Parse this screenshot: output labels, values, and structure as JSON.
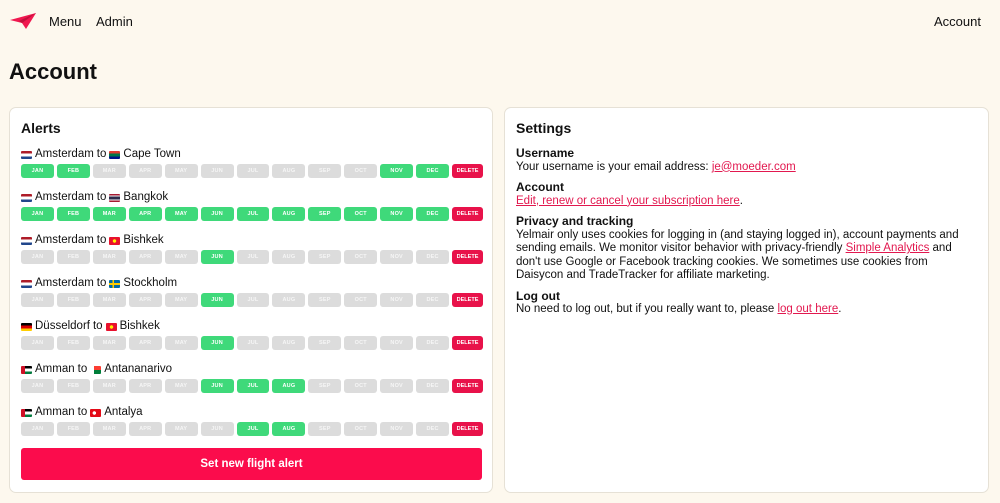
{
  "nav": {
    "menu": "Menu",
    "admin": "Admin",
    "account": "Account",
    "logo_color": "#f0184f"
  },
  "page": {
    "title": "Account"
  },
  "alerts": {
    "title": "Alerts",
    "delete_label": "DELETE",
    "new_alert_label": "Set new flight alert",
    "months": [
      "JAN",
      "FEB",
      "MAR",
      "APR",
      "MAY",
      "JUN",
      "JUL",
      "AUG",
      "SEP",
      "OCT",
      "NOV",
      "DEC"
    ],
    "items": [
      {
        "from": "Amsterdam",
        "from_flag": "nl",
        "to": "Cape Town",
        "to_flag": "za",
        "active": [
          true,
          true,
          false,
          false,
          false,
          false,
          false,
          false,
          false,
          false,
          true,
          true
        ]
      },
      {
        "from": "Amsterdam",
        "from_flag": "nl",
        "to": "Bangkok",
        "to_flag": "th",
        "active": [
          true,
          true,
          true,
          true,
          true,
          true,
          true,
          true,
          true,
          true,
          true,
          true
        ]
      },
      {
        "from": "Amsterdam",
        "from_flag": "nl",
        "to": "Bishkek",
        "to_flag": "kg",
        "active": [
          false,
          false,
          false,
          false,
          false,
          true,
          false,
          false,
          false,
          false,
          false,
          false
        ]
      },
      {
        "from": "Amsterdam",
        "from_flag": "nl",
        "to": "Stockholm",
        "to_flag": "se",
        "active": [
          false,
          false,
          false,
          false,
          false,
          true,
          false,
          false,
          false,
          false,
          false,
          false
        ]
      },
      {
        "from": "Düsseldorf",
        "from_flag": "de",
        "to": "Bishkek",
        "to_flag": "kg",
        "active": [
          false,
          false,
          false,
          false,
          false,
          true,
          false,
          false,
          false,
          false,
          false,
          false
        ]
      },
      {
        "from": "Amman",
        "from_flag": "jo",
        "to": "Antananarivo",
        "to_flag": "mg",
        "active": [
          false,
          false,
          false,
          false,
          false,
          true,
          true,
          true,
          false,
          false,
          false,
          false
        ]
      },
      {
        "from": "Amman",
        "from_flag": "jo",
        "to": "Antalya",
        "to_flag": "tr",
        "active": [
          false,
          false,
          false,
          false,
          false,
          false,
          true,
          true,
          false,
          false,
          false,
          false
        ]
      }
    ]
  },
  "settings": {
    "title": "Settings",
    "username_head": "Username",
    "username_text": "Your username is your email address: ",
    "username_email": "je@moeder.com",
    "account_head": "Account",
    "account_link": "Edit, renew or cancel your subscription here",
    "account_after": ".",
    "privacy_head": "Privacy and tracking",
    "privacy_text_1": "Yelmair only uses cookies for logging in (and staying logged in), account payments and sending emails. We monitor visitor behavior with privacy-friendly ",
    "privacy_link": "Simple Analytics",
    "privacy_text_2": " and don't use Google or Facebook tracking cookies. We sometimes use cookies from Daisycon and TradeTracker for affiliate marketing.",
    "logout_head": "Log out",
    "logout_text": "No need to log out, but if you really want to, please ",
    "logout_link": "log out here",
    "logout_after": "."
  },
  "colors": {
    "background": "#fdf8ee",
    "month_on": "#3fd97a",
    "month_off": "#dcdcdc",
    "delete": "#e8124a",
    "primary_button": "#fb0c4c",
    "link": "#e2184f"
  }
}
